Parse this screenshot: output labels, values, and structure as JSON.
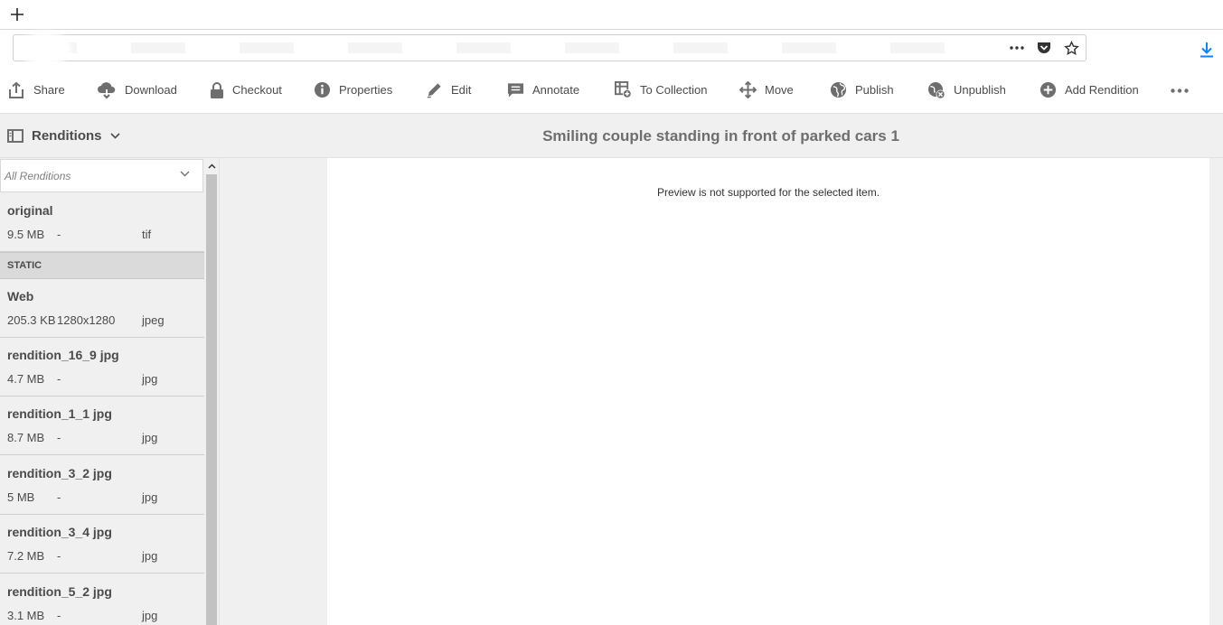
{
  "browser": {
    "newtab_label": "+"
  },
  "toolbar": {
    "actions": [
      {
        "label": "Share"
      },
      {
        "label": "Download"
      },
      {
        "label": "Checkout"
      },
      {
        "label": "Properties"
      },
      {
        "label": "Edit"
      },
      {
        "label": "Annotate"
      },
      {
        "label": "To Collection"
      },
      {
        "label": "Move"
      },
      {
        "label": "Publish"
      },
      {
        "label": "Unpublish"
      },
      {
        "label": "Add Rendition"
      }
    ]
  },
  "header": {
    "rail_label": "Renditions",
    "title": "Smiling couple standing in front of parked cars 1"
  },
  "rail": {
    "filter": "All Renditions",
    "section_label": "STATIC",
    "original": {
      "name": "original",
      "size": "9.5 MB",
      "dim": "-",
      "format": "tif"
    },
    "items": [
      {
        "name": "Web",
        "size": "205.3 KB",
        "dim": "1280x1280",
        "format": "jpeg"
      },
      {
        "name": "rendition_16_9 jpg",
        "size": "4.7 MB",
        "dim": "-",
        "format": "jpg"
      },
      {
        "name": "rendition_1_1 jpg",
        "size": "8.7 MB",
        "dim": "-",
        "format": "jpg"
      },
      {
        "name": "rendition_3_2 jpg",
        "size": "5 MB",
        "dim": "-",
        "format": "jpg"
      },
      {
        "name": "rendition_3_4 jpg",
        "size": "7.2 MB",
        "dim": "-",
        "format": "jpg"
      },
      {
        "name": "rendition_5_2 jpg",
        "size": "3.1 MB",
        "dim": "-",
        "format": "jpg"
      }
    ]
  },
  "preview": {
    "message": "Preview is not supported for the selected item."
  },
  "colors": {
    "icon": "#6e6e6e",
    "rail_bg": "#f0f0f0",
    "section_bg": "#dadada",
    "download_accent": "#0a84ff"
  }
}
